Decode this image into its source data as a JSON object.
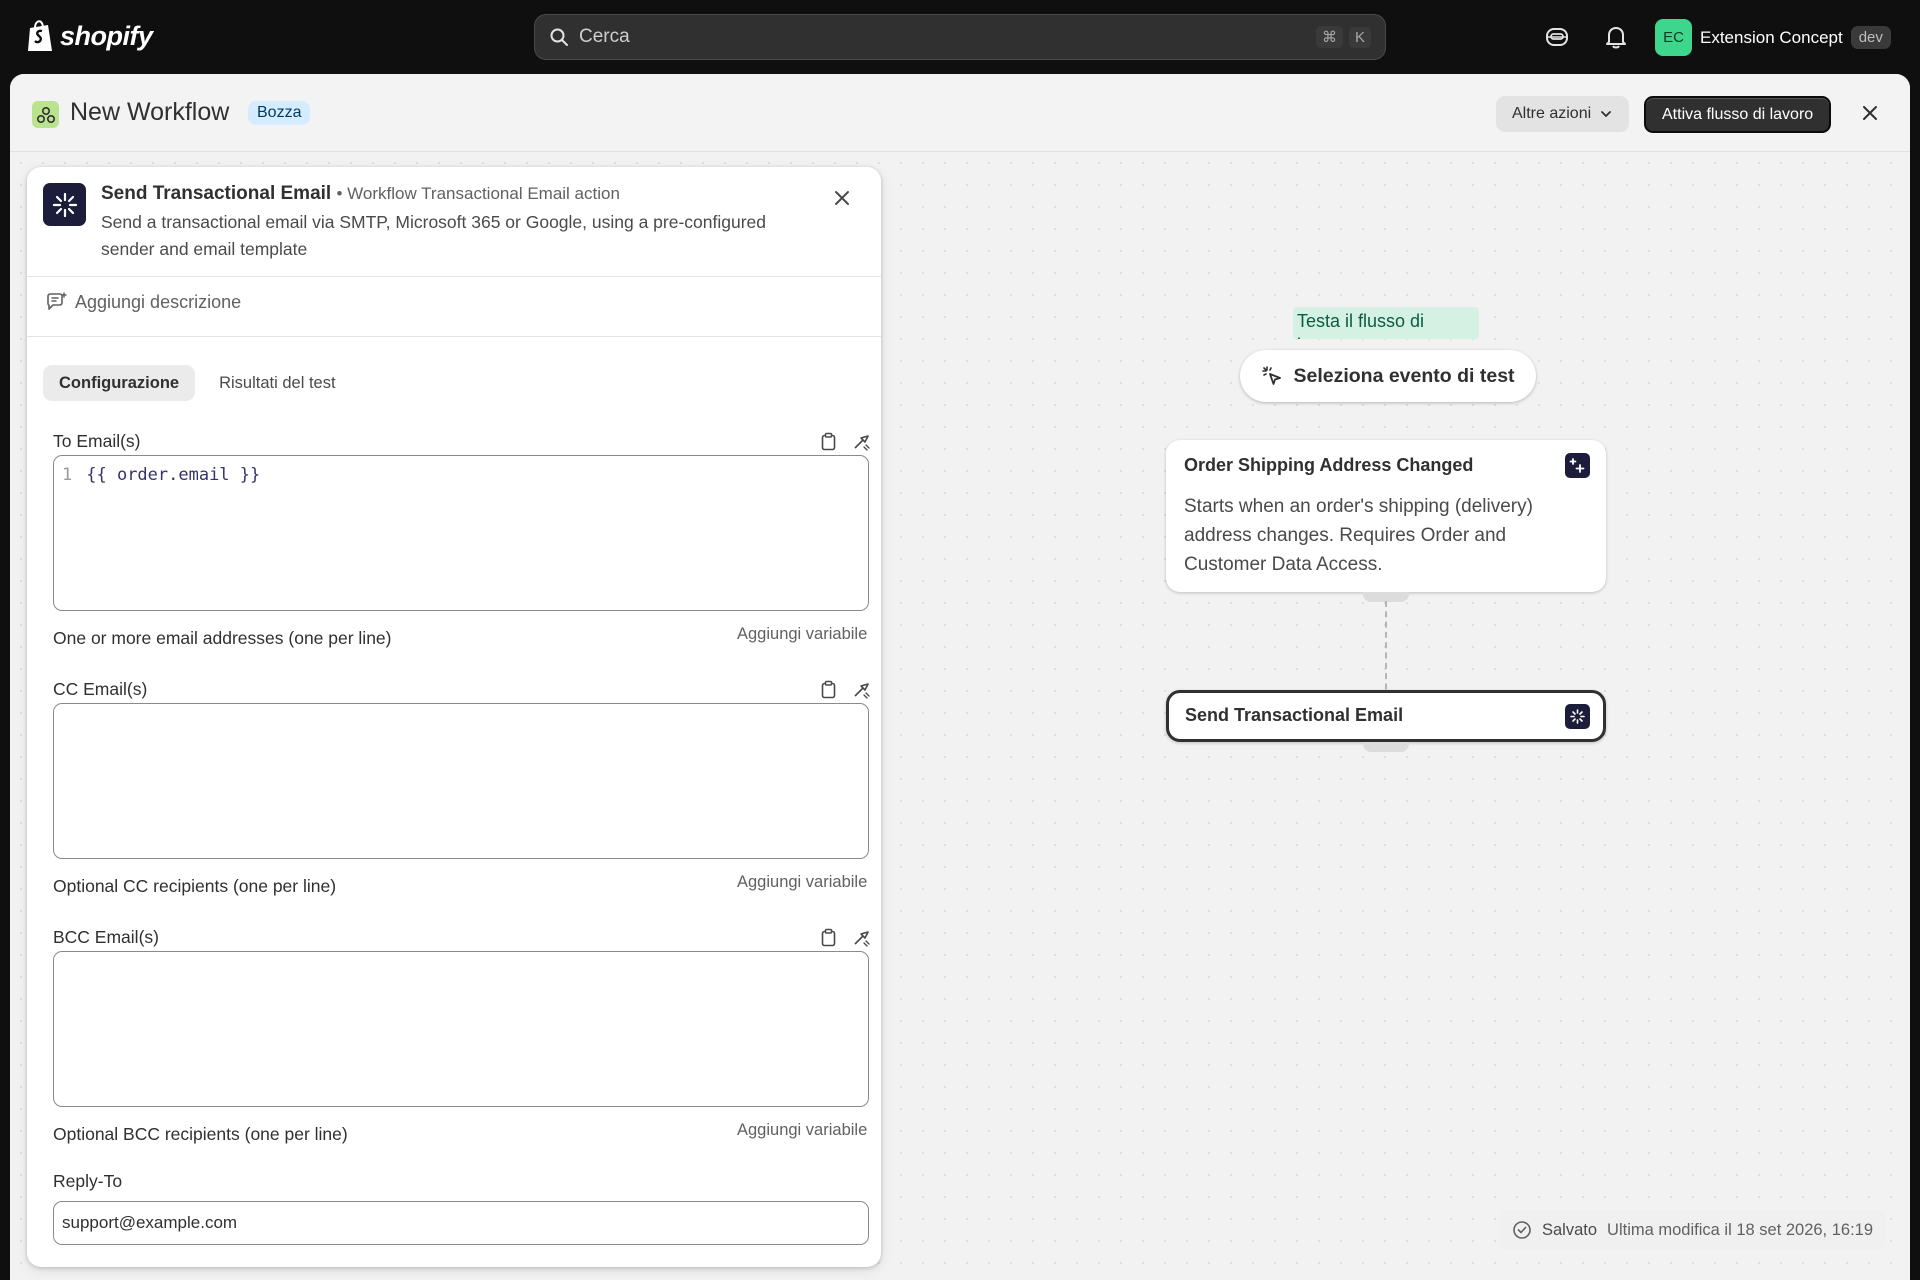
{
  "topbar": {
    "brand": "shopify",
    "search_placeholder": "Cerca",
    "shortcut_cmd": "⌘",
    "shortcut_key": "K",
    "avatar_initials": "EC",
    "account_name": "Extension Concept",
    "env_badge": "dev"
  },
  "header": {
    "title": "New Workflow",
    "status": "Bozza",
    "more_actions": "Altre azioni",
    "activate": "Attiva flusso di lavoro"
  },
  "panel": {
    "title": "Send Transactional Email",
    "subtitle": "Workflow Transactional Email action",
    "description": "Send a transactional email via SMTP, Microsoft 365 or Google, using a pre-configured sender and email template",
    "add_description": "Aggiungi descrizione",
    "tabs": [
      {
        "label": "Configurazione",
        "active": true
      },
      {
        "label": "Risultati del test",
        "active": false
      }
    ],
    "fields": {
      "to": {
        "label": "To Email(s)",
        "line_number": "1",
        "value": "{{ order.email }}",
        "help": "One or more email addresses (one per line)",
        "add_variable": "Aggiungi variabile"
      },
      "cc": {
        "label": "CC Email(s)",
        "help": "Optional CC recipients (one per line)",
        "add_variable": "Aggiungi variabile"
      },
      "bcc": {
        "label": "BCC Email(s)",
        "help": "Optional BCC recipients (one per line)",
        "add_variable": "Aggiungi variabile"
      },
      "reply_to": {
        "label": "Reply-To",
        "value": "support@example.com"
      }
    }
  },
  "canvas": {
    "test_tooltip": "Testa il flusso di lavoro",
    "test_button": "Seleziona evento di test",
    "trigger_node": {
      "title": "Order Shipping Address Changed",
      "description": "Starts when an order's shipping (delivery) address changes. Requires Order and Customer Data Access."
    },
    "action_node": {
      "title": "Send Transactional Email"
    },
    "saved_status": "Salvato",
    "last_modified": "Ultima modifica il 18 set 2026, 16:19"
  },
  "colors": {
    "topbar_bg": "#0f0f0f",
    "avatar_bg": "#3dd68c",
    "draft_badge_bg": "#d5ebff",
    "primary_button": "#303030",
    "app_icon_bg": "#1b1d3a"
  }
}
